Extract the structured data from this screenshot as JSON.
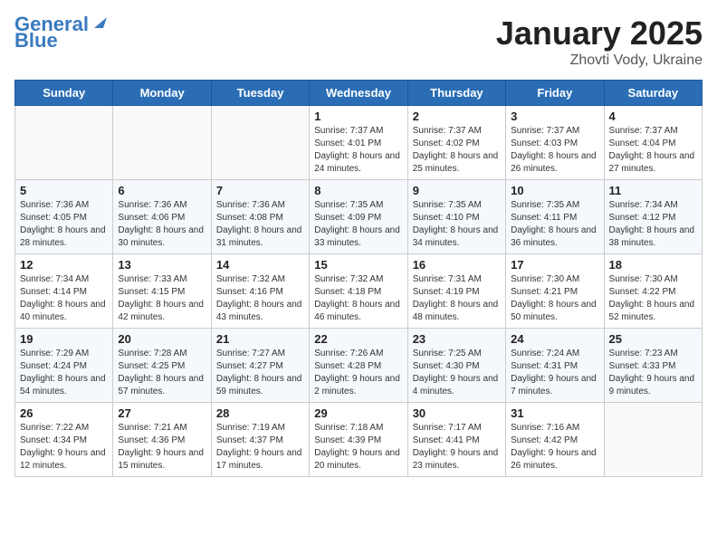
{
  "header": {
    "logo_line1": "General",
    "logo_line2": "Blue",
    "month_title": "January 2025",
    "subtitle": "Zhovti Vody, Ukraine"
  },
  "weekdays": [
    "Sunday",
    "Monday",
    "Tuesday",
    "Wednesday",
    "Thursday",
    "Friday",
    "Saturday"
  ],
  "weeks": [
    [
      {
        "day": "",
        "info": ""
      },
      {
        "day": "",
        "info": ""
      },
      {
        "day": "",
        "info": ""
      },
      {
        "day": "1",
        "info": "Sunrise: 7:37 AM\nSunset: 4:01 PM\nDaylight: 8 hours and 24 minutes."
      },
      {
        "day": "2",
        "info": "Sunrise: 7:37 AM\nSunset: 4:02 PM\nDaylight: 8 hours and 25 minutes."
      },
      {
        "day": "3",
        "info": "Sunrise: 7:37 AM\nSunset: 4:03 PM\nDaylight: 8 hours and 26 minutes."
      },
      {
        "day": "4",
        "info": "Sunrise: 7:37 AM\nSunset: 4:04 PM\nDaylight: 8 hours and 27 minutes."
      }
    ],
    [
      {
        "day": "5",
        "info": "Sunrise: 7:36 AM\nSunset: 4:05 PM\nDaylight: 8 hours and 28 minutes."
      },
      {
        "day": "6",
        "info": "Sunrise: 7:36 AM\nSunset: 4:06 PM\nDaylight: 8 hours and 30 minutes."
      },
      {
        "day": "7",
        "info": "Sunrise: 7:36 AM\nSunset: 4:08 PM\nDaylight: 8 hours and 31 minutes."
      },
      {
        "day": "8",
        "info": "Sunrise: 7:35 AM\nSunset: 4:09 PM\nDaylight: 8 hours and 33 minutes."
      },
      {
        "day": "9",
        "info": "Sunrise: 7:35 AM\nSunset: 4:10 PM\nDaylight: 8 hours and 34 minutes."
      },
      {
        "day": "10",
        "info": "Sunrise: 7:35 AM\nSunset: 4:11 PM\nDaylight: 8 hours and 36 minutes."
      },
      {
        "day": "11",
        "info": "Sunrise: 7:34 AM\nSunset: 4:12 PM\nDaylight: 8 hours and 38 minutes."
      }
    ],
    [
      {
        "day": "12",
        "info": "Sunrise: 7:34 AM\nSunset: 4:14 PM\nDaylight: 8 hours and 40 minutes."
      },
      {
        "day": "13",
        "info": "Sunrise: 7:33 AM\nSunset: 4:15 PM\nDaylight: 8 hours and 42 minutes."
      },
      {
        "day": "14",
        "info": "Sunrise: 7:32 AM\nSunset: 4:16 PM\nDaylight: 8 hours and 43 minutes."
      },
      {
        "day": "15",
        "info": "Sunrise: 7:32 AM\nSunset: 4:18 PM\nDaylight: 8 hours and 46 minutes."
      },
      {
        "day": "16",
        "info": "Sunrise: 7:31 AM\nSunset: 4:19 PM\nDaylight: 8 hours and 48 minutes."
      },
      {
        "day": "17",
        "info": "Sunrise: 7:30 AM\nSunset: 4:21 PM\nDaylight: 8 hours and 50 minutes."
      },
      {
        "day": "18",
        "info": "Sunrise: 7:30 AM\nSunset: 4:22 PM\nDaylight: 8 hours and 52 minutes."
      }
    ],
    [
      {
        "day": "19",
        "info": "Sunrise: 7:29 AM\nSunset: 4:24 PM\nDaylight: 8 hours and 54 minutes."
      },
      {
        "day": "20",
        "info": "Sunrise: 7:28 AM\nSunset: 4:25 PM\nDaylight: 8 hours and 57 minutes."
      },
      {
        "day": "21",
        "info": "Sunrise: 7:27 AM\nSunset: 4:27 PM\nDaylight: 8 hours and 59 minutes."
      },
      {
        "day": "22",
        "info": "Sunrise: 7:26 AM\nSunset: 4:28 PM\nDaylight: 9 hours and 2 minutes."
      },
      {
        "day": "23",
        "info": "Sunrise: 7:25 AM\nSunset: 4:30 PM\nDaylight: 9 hours and 4 minutes."
      },
      {
        "day": "24",
        "info": "Sunrise: 7:24 AM\nSunset: 4:31 PM\nDaylight: 9 hours and 7 minutes."
      },
      {
        "day": "25",
        "info": "Sunrise: 7:23 AM\nSunset: 4:33 PM\nDaylight: 9 hours and 9 minutes."
      }
    ],
    [
      {
        "day": "26",
        "info": "Sunrise: 7:22 AM\nSunset: 4:34 PM\nDaylight: 9 hours and 12 minutes."
      },
      {
        "day": "27",
        "info": "Sunrise: 7:21 AM\nSunset: 4:36 PM\nDaylight: 9 hours and 15 minutes."
      },
      {
        "day": "28",
        "info": "Sunrise: 7:19 AM\nSunset: 4:37 PM\nDaylight: 9 hours and 17 minutes."
      },
      {
        "day": "29",
        "info": "Sunrise: 7:18 AM\nSunset: 4:39 PM\nDaylight: 9 hours and 20 minutes."
      },
      {
        "day": "30",
        "info": "Sunrise: 7:17 AM\nSunset: 4:41 PM\nDaylight: 9 hours and 23 minutes."
      },
      {
        "day": "31",
        "info": "Sunrise: 7:16 AM\nSunset: 4:42 PM\nDaylight: 9 hours and 26 minutes."
      },
      {
        "day": "",
        "info": ""
      }
    ]
  ]
}
